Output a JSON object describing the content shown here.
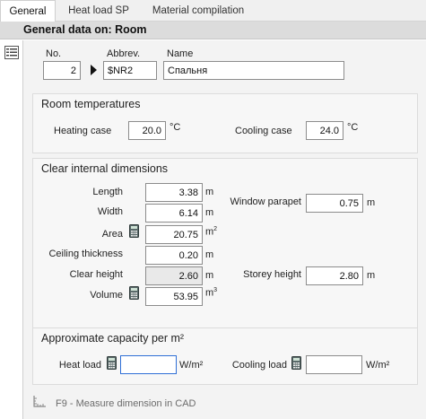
{
  "tabs": [
    {
      "label": "General",
      "active": true
    },
    {
      "label": "Heat load SP",
      "active": false
    },
    {
      "label": "Material compilation",
      "active": false
    }
  ],
  "header": {
    "title": "General data on: Room"
  },
  "general": {
    "no_label": "No.",
    "abbrev_label": "Abbrev.",
    "name_label": "Name",
    "no_value": "2",
    "abbrev_value": "$NR2",
    "name_value": "Спальня"
  },
  "room_temperatures": {
    "title": "Room temperatures",
    "heating_label": "Heating case",
    "heating_value": "20.0",
    "heating_unit": "°C",
    "cooling_label": "Cooling case",
    "cooling_value": "24.0",
    "cooling_unit": "°C"
  },
  "dimensions": {
    "title": "Clear internal dimensions",
    "length_label": "Length",
    "length_value": "3.38",
    "length_unit": "m",
    "width_label": "Width",
    "width_value": "6.14",
    "width_unit": "m",
    "area_label": "Area",
    "area_value": "20.75",
    "area_unit": "m",
    "area_unit_sup": "2",
    "ceiling_label": "Ceiling thickness",
    "ceiling_value": "0.20",
    "ceiling_unit": "m",
    "clear_height_label": "Clear height",
    "clear_height_value": "2.60",
    "clear_height_unit": "m",
    "volume_label": "Volume",
    "volume_value": "53.95",
    "volume_unit": "m",
    "volume_unit_sup": "3",
    "window_parapet_label": "Window parapet",
    "window_parapet_value": "0.75",
    "window_parapet_unit": "m",
    "storey_height_label": "Storey height",
    "storey_height_value": "2.80",
    "storey_height_unit": "m"
  },
  "capacity": {
    "title": "Approximate capacity per m²",
    "heat_load_label": "Heat load",
    "heat_load_value": "",
    "heat_load_unit": "W/m²",
    "cooling_load_label": "Cooling load",
    "cooling_load_value": "",
    "cooling_load_unit": "W/m²"
  },
  "footer": {
    "text": "F9 - Measure dimension in CAD"
  },
  "icons": {
    "list": "list-view-icon",
    "arrow": "record-pointer-icon",
    "calculator": "calculator-icon",
    "measure": "measure-cad-icon"
  }
}
